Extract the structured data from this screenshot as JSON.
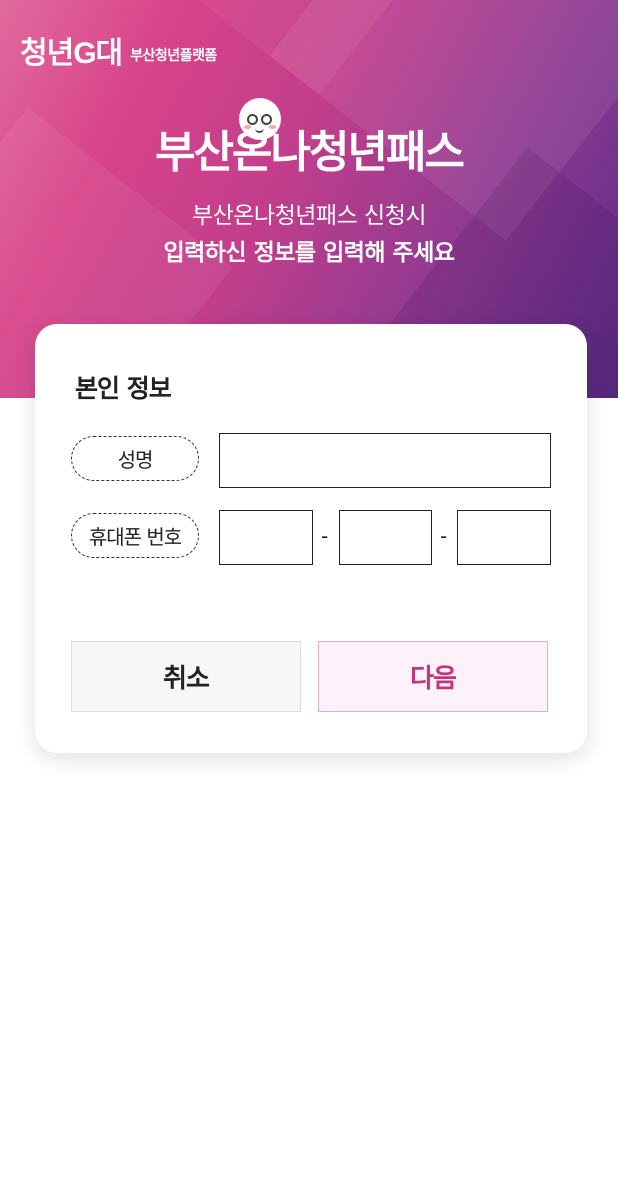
{
  "header": {
    "logo_main": "청년G대",
    "logo_sub": "부산청년플랫폼",
    "title": "부산온나청년패스",
    "subtitle_line1": "부산온나청년패스 신청시",
    "subtitle_line2": "입력하신 정보를 입력해 주세요"
  },
  "form": {
    "section_title": "본인 정보",
    "name_label": "성명",
    "name_value": "",
    "phone_label": "휴대폰 번호",
    "phone_part1": "",
    "phone_part2": "",
    "phone_part3": "",
    "phone_separator": "-"
  },
  "buttons": {
    "cancel_label": "취소",
    "next_label": "다음"
  },
  "colors": {
    "brand_pink": "#d8438a",
    "brand_purple": "#5a2c86",
    "next_text": "#c2357f",
    "next_bg": "#fdf2fa"
  }
}
